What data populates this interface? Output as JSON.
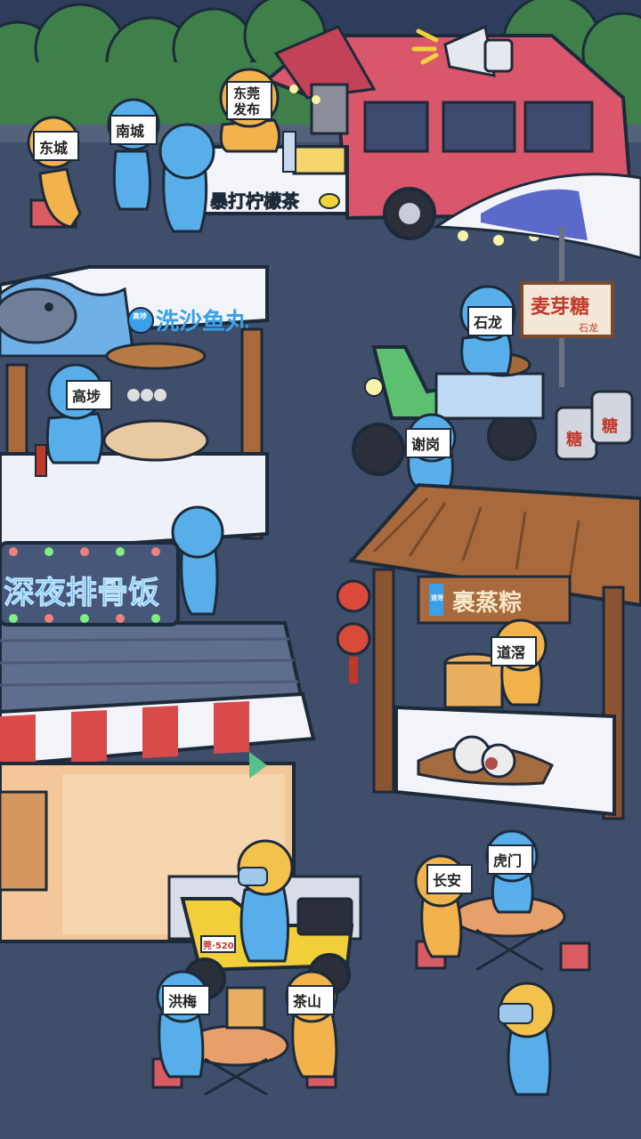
{
  "colors": {
    "ground": "#3f4f6b",
    "sky": "#2e3d5c",
    "bushes": "#3e7f4a",
    "van": "#d9566b",
    "blue_figure": "#58aee8",
    "yellow_figure": "#f2b24c",
    "stall_white": "#f3f4fa",
    "wood": "#a8693d",
    "neon_blue": "#3aa0e8",
    "red_stripe": "#d94a4a"
  },
  "labels": {
    "dongcheng": "东城",
    "nancheng": "南城",
    "dongguan": "东莞",
    "fabu": "发布",
    "gaobu": "高埗",
    "shilong": "石龙",
    "xiegang": "谢岗",
    "daojiao": "道滘",
    "humen": "虎门",
    "changan": "长安",
    "hongmei": "洪梅",
    "chashan": "茶山"
  },
  "signs": {
    "lemon_tea": "暴打柠檬茶",
    "fishball_tag": "高埗",
    "fishball": "洗沙鱼丸",
    "maltose": "麦芽糖",
    "maltose_sub": "石龙",
    "sugar": "糖",
    "zongzi_tag": "道滘",
    "zongzi": "裹蒸粽",
    "ribs_rice": "深夜排骨饭",
    "plate": "莞·520"
  },
  "icons": [
    "megaphone-icon",
    "lemon-icon",
    "fish-icon",
    "lantern-icon",
    "umbrella-icon",
    "scooter-icon",
    "steamer-icon",
    "zongzi-icon",
    "lamp-icon",
    "helmet-icon"
  ]
}
